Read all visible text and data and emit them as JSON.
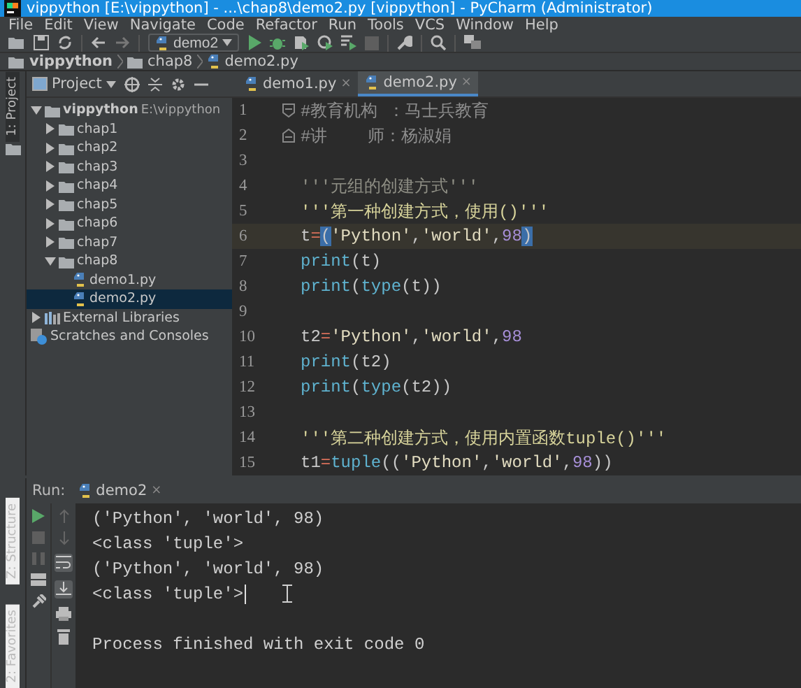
{
  "window": {
    "title": "vippython [E:\\vippython] - ...\\chap8\\demo2.py [vippython] - PyCharm (Administrator)"
  },
  "menu": [
    "File",
    "Edit",
    "View",
    "Navigate",
    "Code",
    "Refactor",
    "Run",
    "Tools",
    "VCS",
    "Window",
    "Help"
  ],
  "toolbar": {
    "run_config": "demo2"
  },
  "breadcrumbs": [
    {
      "label": "vippython",
      "kind": "folder"
    },
    {
      "label": "chap8",
      "kind": "folder"
    },
    {
      "label": "demo2.py",
      "kind": "file"
    }
  ],
  "left_strip": [
    "1: Project"
  ],
  "project": {
    "title": "Project",
    "tree": [
      {
        "label": "vippython",
        "path": "E:\\vippython",
        "kind": "folder",
        "expanded": true,
        "selected": false,
        "children": [
          {
            "label": "chap1",
            "kind": "folder",
            "expanded": false,
            "selected": false
          },
          {
            "label": "chap2",
            "kind": "folder",
            "expanded": false,
            "selected": false
          },
          {
            "label": "chap3",
            "kind": "folder",
            "expanded": false,
            "selected": false
          },
          {
            "label": "chap4",
            "kind": "folder",
            "expanded": false,
            "selected": false
          },
          {
            "label": "chap5",
            "kind": "folder",
            "expanded": false,
            "selected": false
          },
          {
            "label": "chap6",
            "kind": "folder",
            "expanded": false,
            "selected": false
          },
          {
            "label": "chap7",
            "kind": "folder",
            "expanded": false,
            "selected": false
          },
          {
            "label": "chap8",
            "kind": "folder",
            "expanded": true,
            "selected": false,
            "children": [
              {
                "label": "demo1.py",
                "kind": "file",
                "selected": false
              },
              {
                "label": "demo2.py",
                "kind": "file",
                "selected": true
              }
            ]
          }
        ]
      },
      {
        "label": "External Libraries",
        "kind": "libraries",
        "expanded": false,
        "selected": false
      },
      {
        "label": "Scratches and Consoles",
        "kind": "scratches",
        "selected": false
      }
    ]
  },
  "editor": {
    "tabs": [
      {
        "label": "demo1.py",
        "close": "×",
        "selected": false
      },
      {
        "label": "demo2.py",
        "close": "×",
        "selected": true
      }
    ],
    "lines": [
      {
        "number": "1",
        "current": false,
        "kind": "fold_start",
        "tokens": [
          {
            "kind": "comment",
            "text": "#教育机构 ：马士兵教育"
          }
        ]
      },
      {
        "number": "2",
        "current": false,
        "kind": "fold_end",
        "tokens": [
          {
            "kind": "comment",
            "text": "#讲    师：杨淑娟"
          }
        ]
      },
      {
        "number": "3",
        "current": false,
        "kind": "code"
      },
      {
        "number": "4",
        "current": false,
        "kind": "code",
        "tokens": [
          {
            "kind": "weak",
            "text": "'''元组的创建方式'''"
          }
        ]
      },
      {
        "number": "5",
        "current": false,
        "kind": "code",
        "tokens": [
          {
            "kind": "docstring",
            "text": "'''第一种创建方式，使用()'''"
          }
        ]
      },
      {
        "number": "6",
        "current": true,
        "kind": "code",
        "tokens": [
          {
            "kind": "plain",
            "text": "t"
          },
          {
            "kind": "op",
            "text": "="
          },
          {
            "kind": "match",
            "text": "("
          },
          {
            "kind": "string",
            "text": "'Python'"
          },
          {
            "kind": "plain",
            "text": ","
          },
          {
            "kind": "string",
            "text": "'world'"
          },
          {
            "kind": "plain",
            "text": ","
          },
          {
            "kind": "number",
            "text": "98"
          },
          {
            "kind": "match",
            "text": ")"
          }
        ]
      },
      {
        "number": "7",
        "current": false,
        "kind": "code",
        "tokens": [
          {
            "kind": "builtin",
            "text": "print"
          },
          {
            "kind": "plain",
            "text": "(t)"
          }
        ]
      },
      {
        "number": "8",
        "current": false,
        "kind": "code",
        "tokens": [
          {
            "kind": "builtin",
            "text": "print"
          },
          {
            "kind": "plain",
            "text": "("
          },
          {
            "kind": "builtin",
            "text": "type"
          },
          {
            "kind": "plain",
            "text": "(t))"
          }
        ]
      },
      {
        "number": "9",
        "current": false,
        "kind": "code"
      },
      {
        "number": "10",
        "current": false,
        "kind": "code",
        "tokens": [
          {
            "kind": "plain",
            "text": "t2"
          },
          {
            "kind": "op",
            "text": "="
          },
          {
            "kind": "string",
            "text": "'Python'"
          },
          {
            "kind": "plain",
            "text": ","
          },
          {
            "kind": "string",
            "text": "'world'"
          },
          {
            "kind": "plain",
            "text": ","
          },
          {
            "kind": "number",
            "text": "98"
          }
        ]
      },
      {
        "number": "11",
        "current": false,
        "kind": "code",
        "tokens": [
          {
            "kind": "builtin",
            "text": "print"
          },
          {
            "kind": "plain",
            "text": "(t2)"
          }
        ]
      },
      {
        "number": "12",
        "current": false,
        "kind": "code",
        "tokens": [
          {
            "kind": "builtin",
            "text": "print"
          },
          {
            "kind": "plain",
            "text": "("
          },
          {
            "kind": "builtin",
            "text": "type"
          },
          {
            "kind": "plain",
            "text": "(t2))"
          }
        ]
      },
      {
        "number": "13",
        "current": false,
        "kind": "code"
      },
      {
        "number": "14",
        "current": false,
        "kind": "code",
        "tokens": [
          {
            "kind": "docstring",
            "text": "'''第二种创建方式，使用内置函数tuple()'''"
          }
        ]
      },
      {
        "number": "15",
        "current": false,
        "kind": "code",
        "tokens": [
          {
            "kind": "plain",
            "text": "t1"
          },
          {
            "kind": "op",
            "text": "="
          },
          {
            "kind": "builtin",
            "text": "tuple"
          },
          {
            "kind": "plain",
            "text": "(("
          },
          {
            "kind": "string",
            "text": "'Python'"
          },
          {
            "kind": "plain",
            "text": ","
          },
          {
            "kind": "string",
            "text": "'world'"
          },
          {
            "kind": "plain",
            "text": ","
          },
          {
            "kind": "number",
            "text": "98"
          },
          {
            "kind": "plain",
            "text": "))"
          }
        ]
      }
    ]
  },
  "run": {
    "label": "Run:",
    "tab": "demo2",
    "close": "×",
    "output": [
      {
        "kind": "stdout",
        "text": "('Python', 'world', 98)",
        "caret": false
      },
      {
        "kind": "stdout",
        "text": "<class 'tuple'>",
        "caret": false
      },
      {
        "kind": "stdout",
        "text": "('Python', 'world', 98)",
        "caret": false
      },
      {
        "kind": "stdout",
        "text": "<class 'tuple'>",
        "caret": true
      },
      {
        "kind": "exit",
        "text": "Process finished with exit code 0",
        "caret": false
      }
    ]
  },
  "bottom_strip": [
    "Z: Structure",
    "2: Favorites"
  ]
}
